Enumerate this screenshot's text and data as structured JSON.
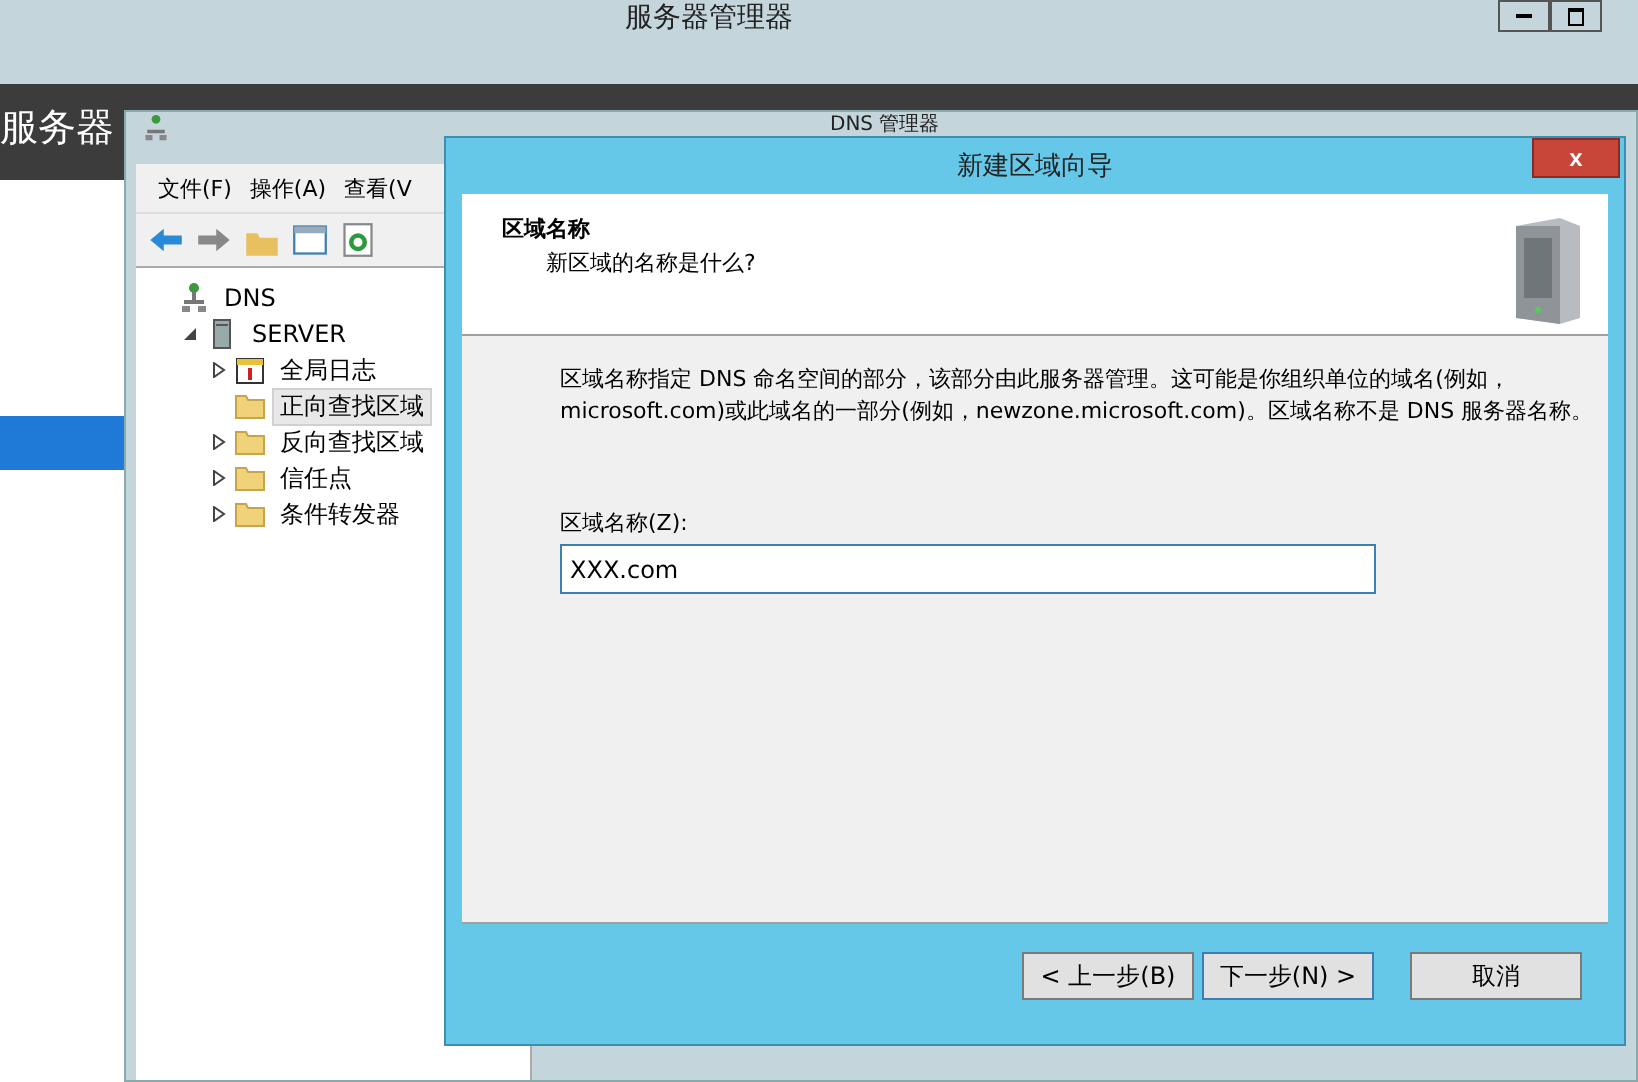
{
  "server_manager": {
    "title": "服务器管理器",
    "breadcrumb": "服务器"
  },
  "sidebar": {
    "items": [
      {
        "selected": true
      }
    ]
  },
  "dns_window": {
    "title": "DNS 管理器",
    "menu": [
      "文件(F)",
      "操作(A)",
      "查看(V"
    ],
    "tree": [
      {
        "label": "DNS",
        "kind": "dns",
        "selected": false,
        "children": [
          {
            "label": "SERVER",
            "kind": "server",
            "expanded": true,
            "selected": false,
            "children": [
              {
                "label": "全局日志",
                "kind": "log",
                "expanded": false,
                "selected": false
              },
              {
                "label": "正向查找区域",
                "kind": "folder",
                "selected": true
              },
              {
                "label": "反向查找区域",
                "kind": "folder",
                "expanded": false,
                "selected": false
              },
              {
                "label": "信任点",
                "kind": "folder",
                "expanded": false,
                "selected": false
              },
              {
                "label": "条件转发器",
                "kind": "folder",
                "expanded": false,
                "selected": false
              }
            ]
          }
        ]
      }
    ]
  },
  "wizard": {
    "title": "新建区域向导",
    "close": "x",
    "heading": "区域名称",
    "subheading": "新区域的名称是什么?",
    "description": "区域名称指定 DNS 命名空间的部分，该部分由此服务器管理。这可能是你组织单位的域名(例如，microsoft.com)或此域名的一部分(例如，newzone.microsoft.com)。区域名称不是 DNS 服务器名称。",
    "field": {
      "label": "区域名称(Z):",
      "value": "XXX.com"
    },
    "buttons": [
      {
        "label": "< 上一步(B)",
        "focused": false
      },
      {
        "label": "下一步(N) >",
        "focused": true
      },
      {
        "label": "取消",
        "focused": false
      }
    ]
  }
}
